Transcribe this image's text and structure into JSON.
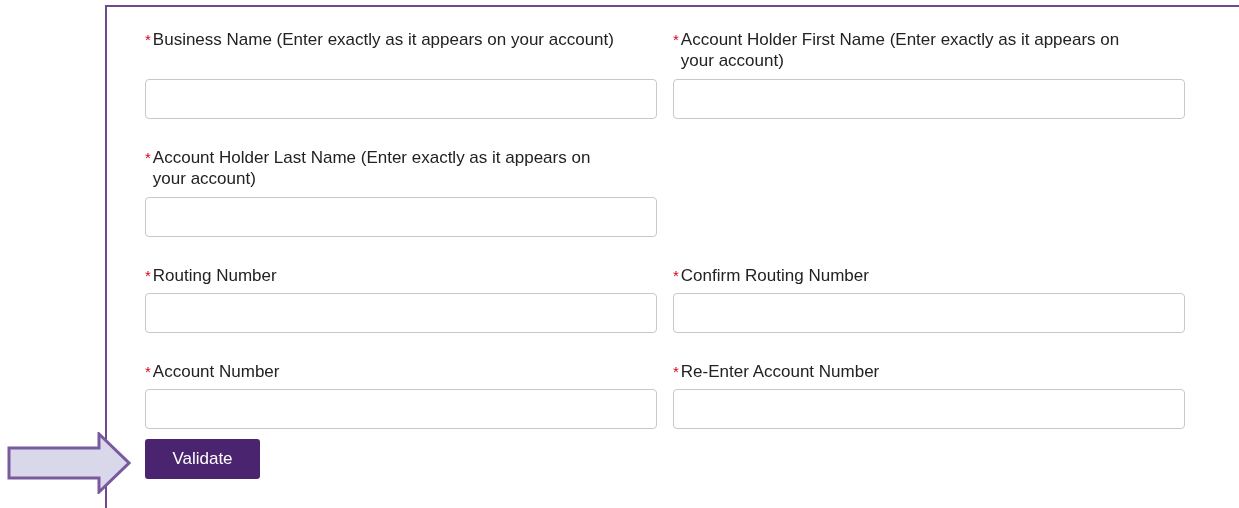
{
  "form": {
    "rows": [
      [
        {
          "required_mark": "*",
          "label": "Business Name (Enter exactly as it appears on your account)"
        },
        {
          "required_mark": "*",
          "label": "Account Holder First Name (Enter exactly as it appears on your account)"
        }
      ],
      [
        {
          "required_mark": "*",
          "label": "Account Holder Last Name (Enter exactly as it appears on your account)"
        }
      ],
      [
        {
          "required_mark": "*",
          "label": "Routing Number"
        },
        {
          "required_mark": "*",
          "label": "Confirm Routing Number"
        }
      ],
      [
        {
          "required_mark": "*",
          "label": "Account Number"
        },
        {
          "required_mark": "*",
          "label": "Re-Enter Account Number"
        }
      ]
    ],
    "submit_button": "Validate"
  }
}
